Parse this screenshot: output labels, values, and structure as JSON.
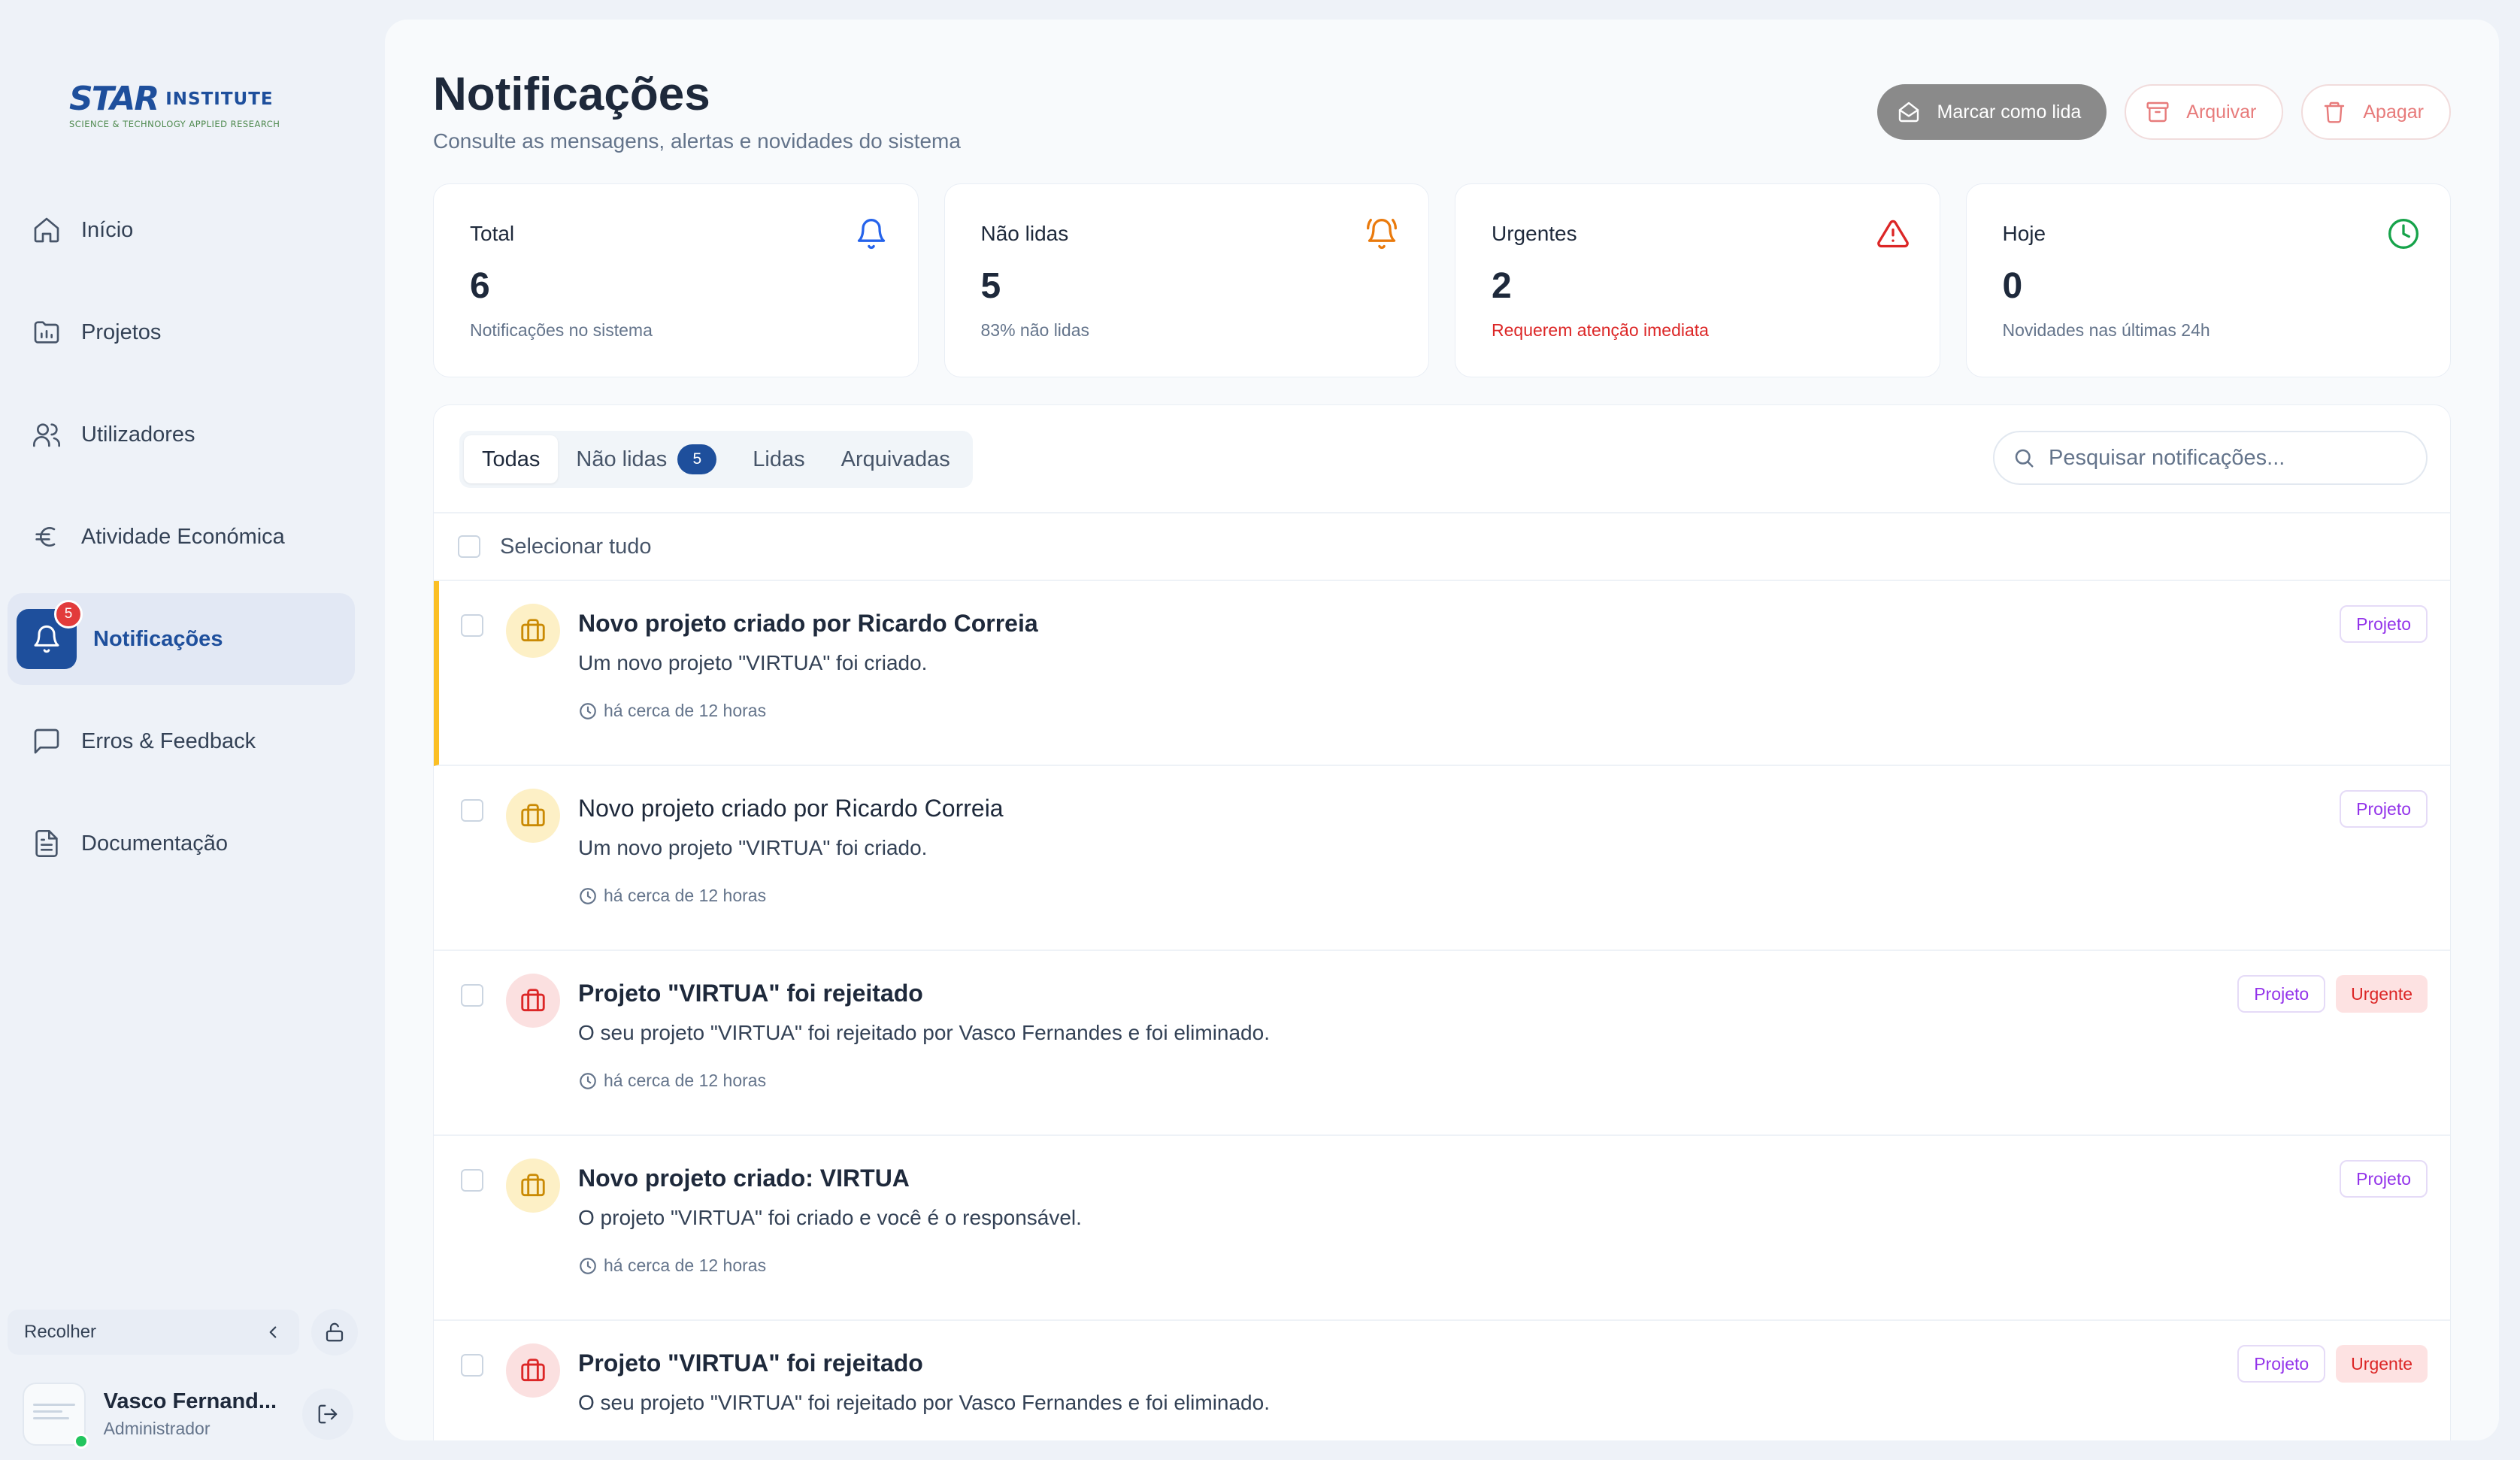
{
  "brand": {
    "logo_main": "STAR",
    "logo_suffix": "INSTITUTE",
    "logo_sub": "SCIENCE & TECHNOLOGY APPLIED RESEARCH"
  },
  "sidebar": {
    "items": [
      {
        "label": "Início",
        "icon": "home-icon"
      },
      {
        "label": "Projetos",
        "icon": "folder-chart-icon"
      },
      {
        "label": "Utilizadores",
        "icon": "users-icon"
      },
      {
        "label": "Atividade Económica",
        "icon": "euro-icon"
      },
      {
        "label": "Notificações",
        "icon": "bell-icon",
        "badge": "5",
        "active": true
      },
      {
        "label": "Erros & Feedback",
        "icon": "message-icon"
      },
      {
        "label": "Documentação",
        "icon": "document-icon"
      }
    ],
    "collapse_label": "Recolher",
    "user": {
      "name": "Vasco Fernand...",
      "role": "Administrador"
    }
  },
  "header": {
    "title": "Notificações",
    "subtitle": "Consulte as mensagens, alertas e novidades do sistema",
    "actions": {
      "mark_read": "Marcar como lida",
      "archive": "Arquivar",
      "delete": "Apagar"
    }
  },
  "stats": [
    {
      "label": "Total",
      "value": "6",
      "note": "Notificações no sistema",
      "icon": "bell-icon",
      "color": "#2563eb"
    },
    {
      "label": "Não lidas",
      "value": "5",
      "note": "83% não lidas",
      "icon": "bell-ring-icon",
      "color": "#ea7a0c"
    },
    {
      "label": "Urgentes",
      "value": "2",
      "note": "Requerem atenção imediata",
      "icon": "alert-triangle-icon",
      "color": "#dc2626"
    },
    {
      "label": "Hoje",
      "value": "0",
      "note": "Novidades nas últimas 24h",
      "icon": "clock-icon",
      "color": "#16a34a"
    }
  ],
  "tabs": [
    {
      "label": "Todas",
      "active": true
    },
    {
      "label": "Não lidas",
      "count": "5"
    },
    {
      "label": "Lidas"
    },
    {
      "label": "Arquivadas"
    }
  ],
  "search": {
    "placeholder": "Pesquisar notificações..."
  },
  "select_all_label": "Selecionar tudo",
  "notifications": [
    {
      "title": "Novo projeto criado por Ricardo Correia",
      "text": "Um novo projeto \"VIRTUA\" foi criado.",
      "time": "há cerca de 12 horas",
      "tags": [
        "Projeto"
      ],
      "icon_color": "yellow"
    },
    {
      "title": "Novo projeto criado por Ricardo Correia",
      "text": "Um novo projeto \"VIRTUA\" foi criado.",
      "time": "há cerca de 12 horas",
      "tags": [
        "Projeto"
      ],
      "icon_color": "yellow"
    },
    {
      "title": "Projeto \"VIRTUA\" foi rejeitado",
      "text": "O seu projeto \"VIRTUA\" foi rejeitado por Vasco Fernandes e foi eliminado.",
      "time": "há cerca de 12 horas",
      "tags": [
        "Projeto",
        "Urgente"
      ],
      "icon_color": "red"
    },
    {
      "title": "Novo projeto criado: VIRTUA",
      "text": "O projeto \"VIRTUA\" foi criado e você é o responsável.",
      "time": "há cerca de 12 horas",
      "tags": [
        "Projeto"
      ],
      "icon_color": "yellow"
    },
    {
      "title": "Projeto \"VIRTUA\" foi rejeitado",
      "text": "O seu projeto \"VIRTUA\" foi rejeitado por Vasco Fernandes e foi eliminado.",
      "time": "",
      "tags": [
        "Projeto",
        "Urgente"
      ],
      "icon_color": "red"
    }
  ],
  "colors": {
    "accent": "#1e4f9c",
    "urgent": "#dc2626",
    "highlight": "#fbbf24",
    "tag_project": "#9333ea"
  }
}
